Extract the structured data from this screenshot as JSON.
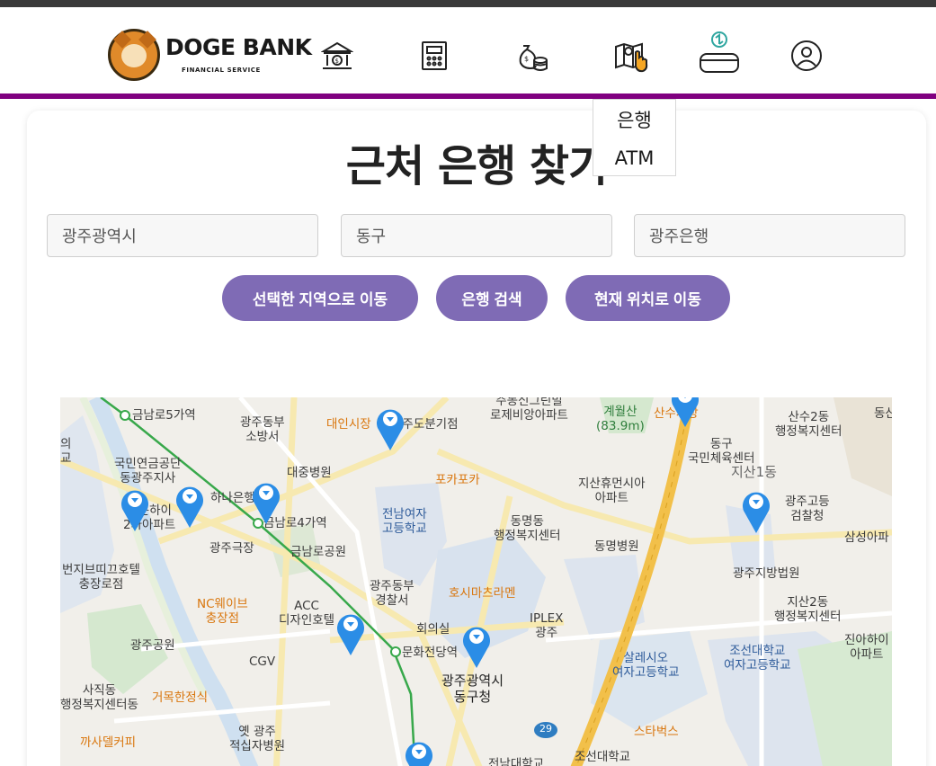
{
  "header": {
    "logo_title": "DOGE BANK",
    "logo_subtitle": "FINANCIAL SERVICE",
    "nav_icons": [
      "bank-icon",
      "calculator-icon",
      "money-bag-icon",
      "map-search-icon",
      "card-exchange-icon",
      "user-icon"
    ],
    "accent_color": "#800080"
  },
  "dropdown": {
    "items": [
      "은행",
      "ATM"
    ]
  },
  "page": {
    "title": "근처 은행 찾기"
  },
  "filters": {
    "city": "광주광역시",
    "district": "동구",
    "bank": "광주은행"
  },
  "buttons": {
    "move_region": "선택한 지역으로 이동",
    "search_bank": "은행 검색",
    "current_location": "현재 위치로 이동",
    "color": "#7f6bb5"
  },
  "map": {
    "labels": [
      "금남로5가역",
      "광주동부\n소방서",
      "대인시장",
      "광주도분기점",
      "주동신그린빌\n로제비앙아파트",
      "계월산\n(83.9m)",
      "산수시장",
      "산수2동\n행정복지센터",
      "동산",
      "국민연금공단\n동광주지사",
      "대중병원",
      "동구\n국민체육센터",
      "지산1동",
      "하나은행",
      "신운하이\n2차아파트",
      "포카포카",
      "지산휴먼시아\n아파트",
      "금남로4가역",
      "전남여자\n고등학교",
      "동명동\n행정복지센터",
      "동명병원",
      "광주고등\n검찰청",
      "삼성아파",
      "광주극장",
      "금남로공원",
      "번지브띠끄호텔\n충장로점",
      "광주동부\n경찰서",
      "광주지방법원",
      "호시마츠라멘",
      "IPLEX\n광주",
      "지산2동\n행정복지센터",
      "NC웨이브\n충장점",
      "ACC\n디자인호텔",
      "회의실",
      "광주공원",
      "문화전당역",
      "진아하이\n아파트",
      "CGV",
      "살레시오\n여자고등학교",
      "조선대학교\n여자고등학교",
      "광주광역시\n동구청",
      "사직동\n행정복지센터동",
      "거목한정식",
      "옛 광주\n적십자병원",
      "스타벅스",
      "까사델커피",
      "조선대학교",
      "전남대학교",
      "29",
      "의\n교"
    ]
  }
}
